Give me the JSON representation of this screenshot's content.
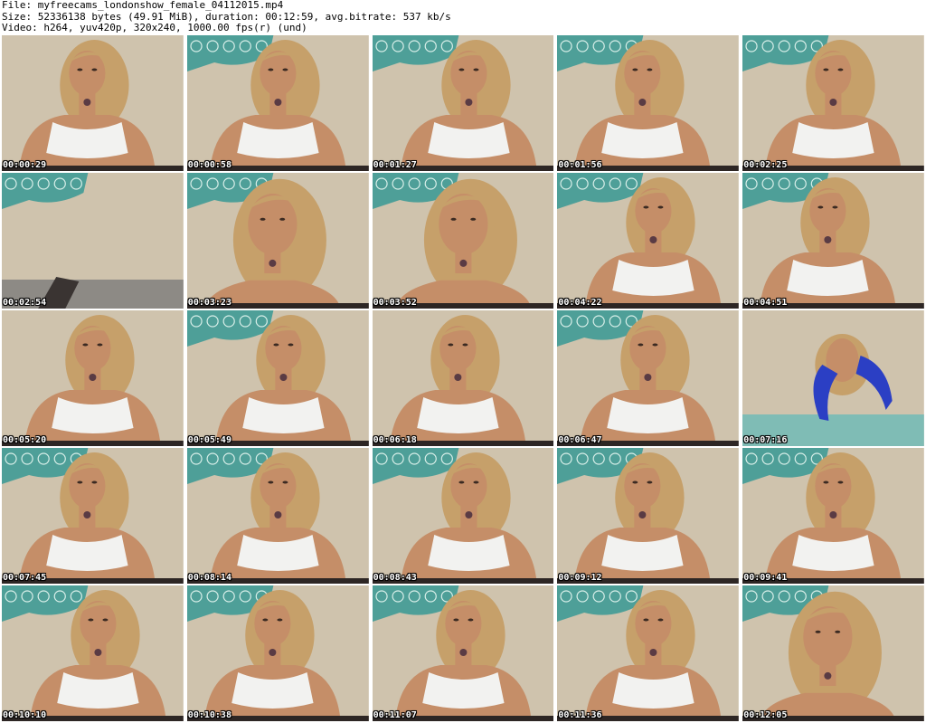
{
  "header": {
    "line1": "File: myfreecams_londonshow_female_04112015.mp4",
    "line2": "Size: 52336138 bytes (49.91 MiB), duration: 00:12:59, avg.bitrate: 537 kb/s",
    "line3": "Video: h264, yuv420p, 320x240, 1000.00 fps(r) (und)"
  },
  "colors": {
    "wall": "#cfc3ad",
    "skin": "#c58e68",
    "hair": "#c6a06a",
    "top": "#f2f2f0",
    "tapestry": "#4e9f98",
    "timestamp_text": "#ffffff"
  },
  "thumbnails": [
    {
      "time": "00:00:29",
      "scene": "portrait",
      "tapestry": false
    },
    {
      "time": "00:00:58",
      "scene": "portrait",
      "tapestry": true
    },
    {
      "time": "00:01:27",
      "scene": "portrait",
      "tapestry": true
    },
    {
      "time": "00:01:56",
      "scene": "portrait",
      "tapestry": true
    },
    {
      "time": "00:02:25",
      "scene": "portrait",
      "tapestry": true
    },
    {
      "time": "00:02:54",
      "scene": "empty",
      "tapestry": true
    },
    {
      "time": "00:03:23",
      "scene": "close",
      "tapestry": true
    },
    {
      "time": "00:03:52",
      "scene": "close",
      "tapestry": true
    },
    {
      "time": "00:04:22",
      "scene": "portrait",
      "tapestry": true
    },
    {
      "time": "00:04:51",
      "scene": "portrait",
      "tapestry": true
    },
    {
      "time": "00:05:20",
      "scene": "portrait",
      "tapestry": false
    },
    {
      "time": "00:05:49",
      "scene": "portrait",
      "tapestry": true
    },
    {
      "time": "00:06:18",
      "scene": "portrait",
      "tapestry": false
    },
    {
      "time": "00:06:47",
      "scene": "portrait",
      "tapestry": true
    },
    {
      "time": "00:07:16",
      "scene": "shoes",
      "tapestry": false
    },
    {
      "time": "00:07:45",
      "scene": "portrait",
      "tapestry": true
    },
    {
      "time": "00:08:14",
      "scene": "portrait",
      "tapestry": true
    },
    {
      "time": "00:08:43",
      "scene": "portrait",
      "tapestry": true
    },
    {
      "time": "00:09:12",
      "scene": "portrait",
      "tapestry": true
    },
    {
      "time": "00:09:41",
      "scene": "portrait",
      "tapestry": true
    },
    {
      "time": "00:10:10",
      "scene": "portrait",
      "tapestry": true
    },
    {
      "time": "00:10:38",
      "scene": "portrait",
      "tapestry": true
    },
    {
      "time": "00:11:07",
      "scene": "portrait",
      "tapestry": true
    },
    {
      "time": "00:11:36",
      "scene": "portrait",
      "tapestry": true
    },
    {
      "time": "00:12:05",
      "scene": "close",
      "tapestry": true
    }
  ]
}
